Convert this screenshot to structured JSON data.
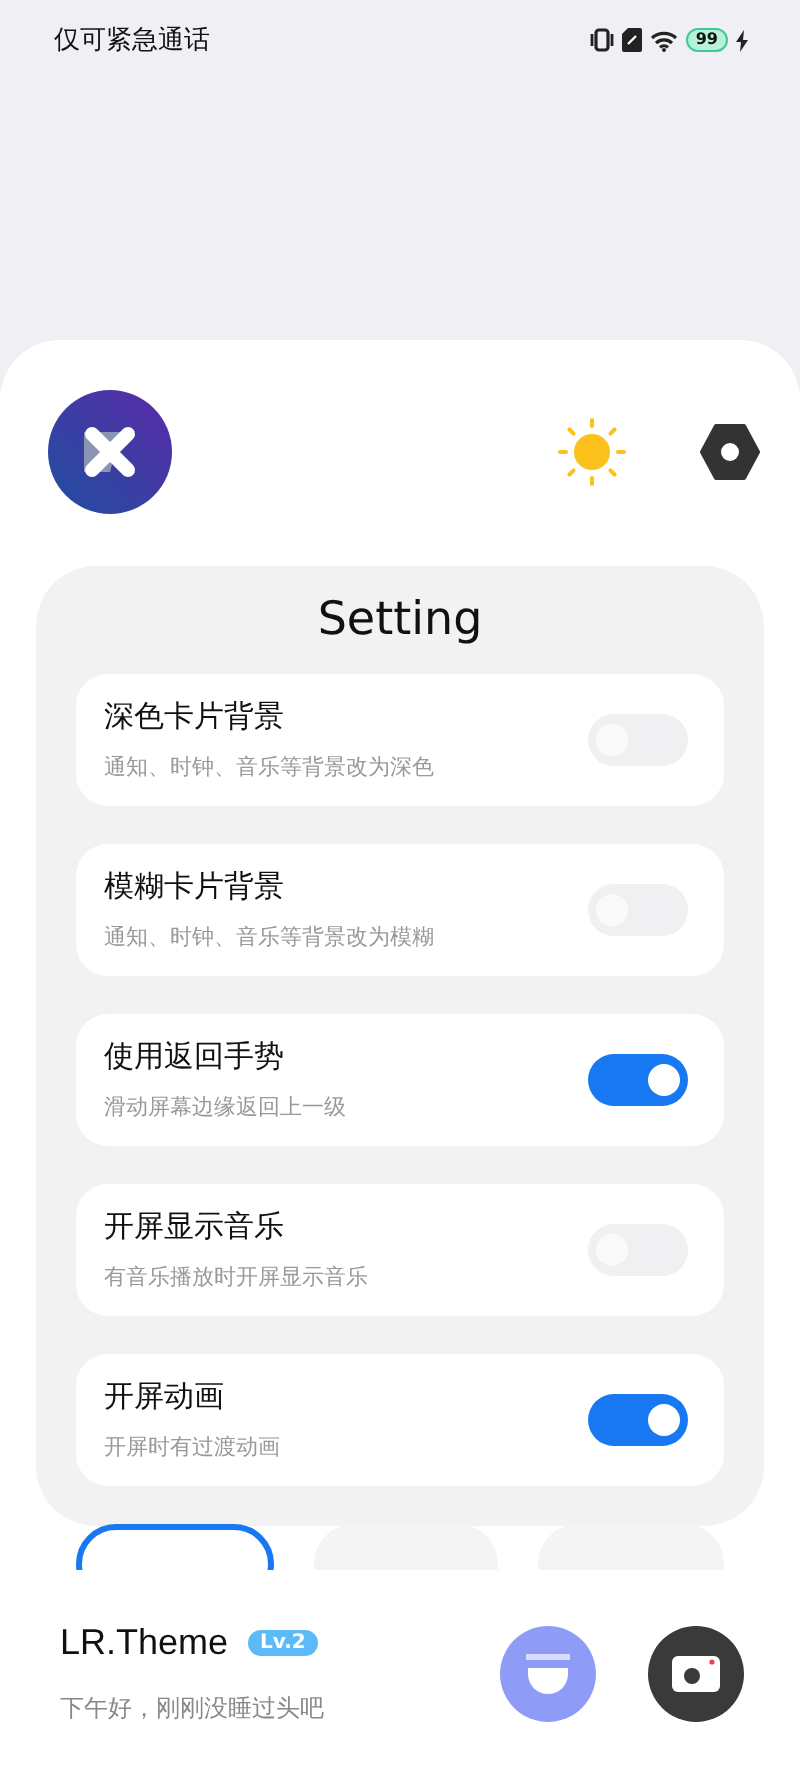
{
  "status_bar": {
    "carrier": "仅可紧急通话",
    "battery": "99"
  },
  "panel": {
    "title": "Setting"
  },
  "settings": [
    {
      "title": "深色卡片背景",
      "subtitle": "通知、时钟、音乐等背景改为深色",
      "on": false
    },
    {
      "title": "模糊卡片背景",
      "subtitle": "通知、时钟、音乐等背景改为模糊",
      "on": false
    },
    {
      "title": "使用返回手势",
      "subtitle": "滑动屏幕边缘返回上一级",
      "on": true
    },
    {
      "title": "开屏显示音乐",
      "subtitle": "有音乐播放时开屏显示音乐",
      "on": false
    },
    {
      "title": "开屏动画",
      "subtitle": "开屏时有过渡动画",
      "on": true
    }
  ],
  "tabs": [
    {
      "selected": true
    },
    {
      "selected": false
    },
    {
      "selected": false
    }
  ],
  "profile": {
    "name": "LR.Theme",
    "level": "Lv.2",
    "greeting": "下午好，刚刚没睡过头吧"
  }
}
